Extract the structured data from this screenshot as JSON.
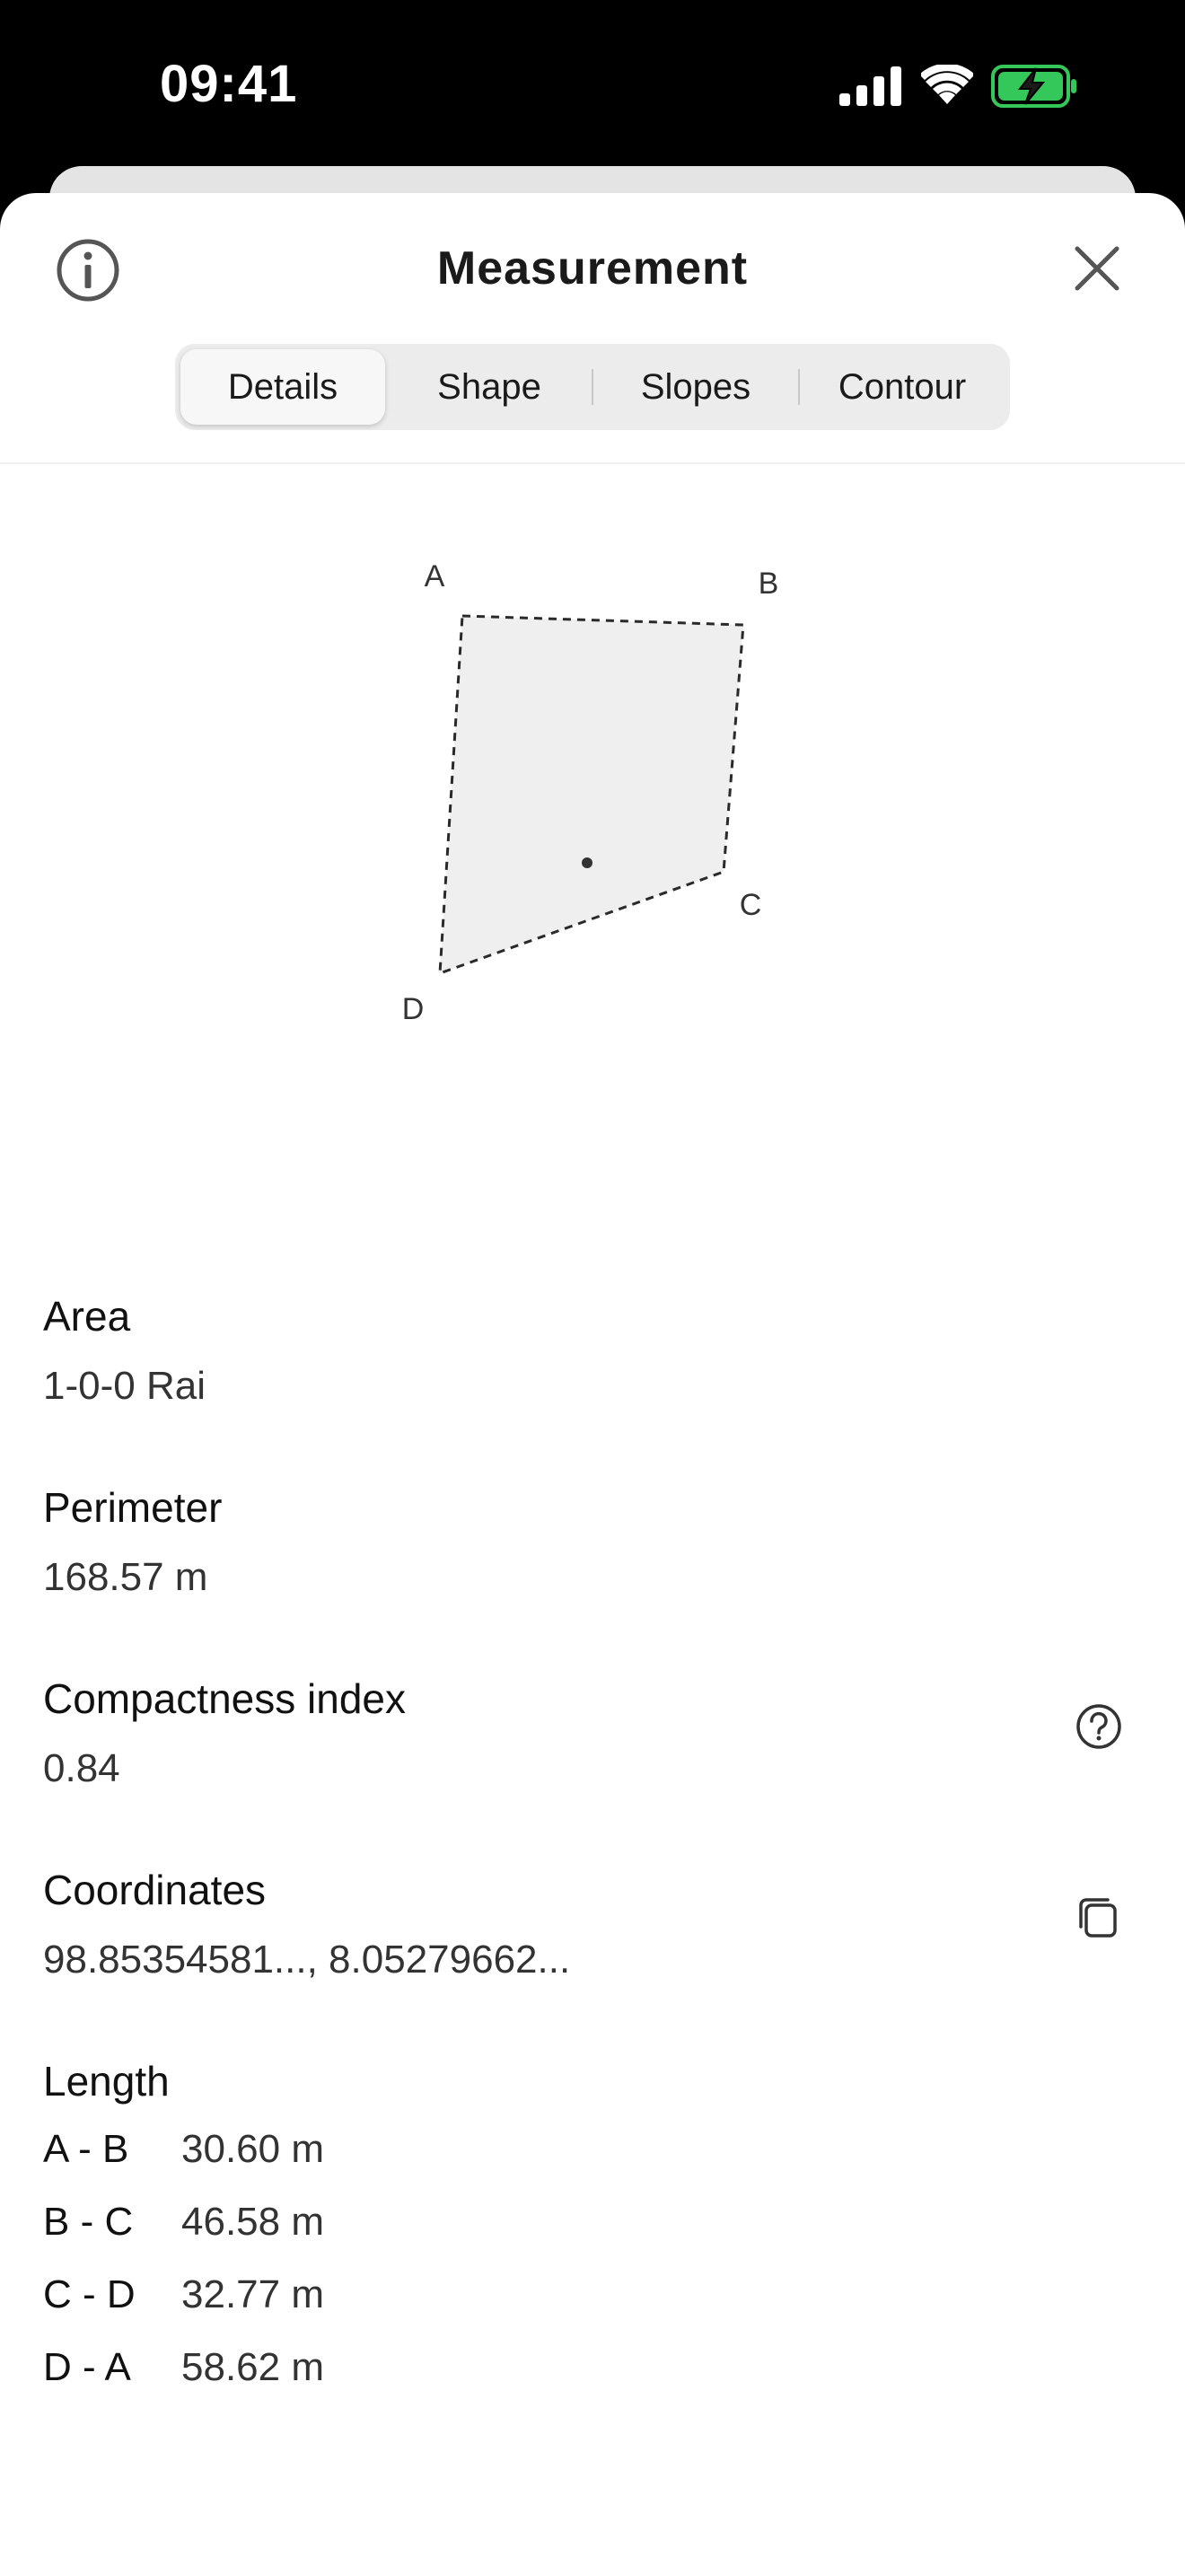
{
  "status_bar": {
    "time": "09:41",
    "battery_color": "#34c759"
  },
  "header": {
    "title": "Measurement",
    "info_icon": "info-icon",
    "close_icon": "close-icon"
  },
  "tabs": [
    {
      "label": "Details",
      "active": true
    },
    {
      "label": "Shape",
      "active": false
    },
    {
      "label": "Slopes",
      "active": false
    },
    {
      "label": "Contour",
      "active": false
    }
  ],
  "shape": {
    "vertices": [
      "A",
      "B",
      "C",
      "D"
    ],
    "fill_color": "#eeefee"
  },
  "details": {
    "area": {
      "label": "Area",
      "value": "1-0-0 Rai"
    },
    "perimeter": {
      "label": "Perimeter",
      "value": "168.57 m"
    },
    "compactness": {
      "label": "Compactness index",
      "value": "0.84",
      "icon": "help-circle-icon"
    },
    "coordinates": {
      "label": "Coordinates",
      "value": "98.85354581..., 8.05279662...",
      "icon": "copy-icon"
    }
  },
  "length": {
    "label": "Length",
    "rows": [
      {
        "segment": "A - B",
        "value": "30.60 m"
      },
      {
        "segment": "B - C",
        "value": "46.58 m"
      },
      {
        "segment": "C - D",
        "value": "32.77 m"
      },
      {
        "segment": "D - A",
        "value": "58.62 m"
      }
    ]
  }
}
